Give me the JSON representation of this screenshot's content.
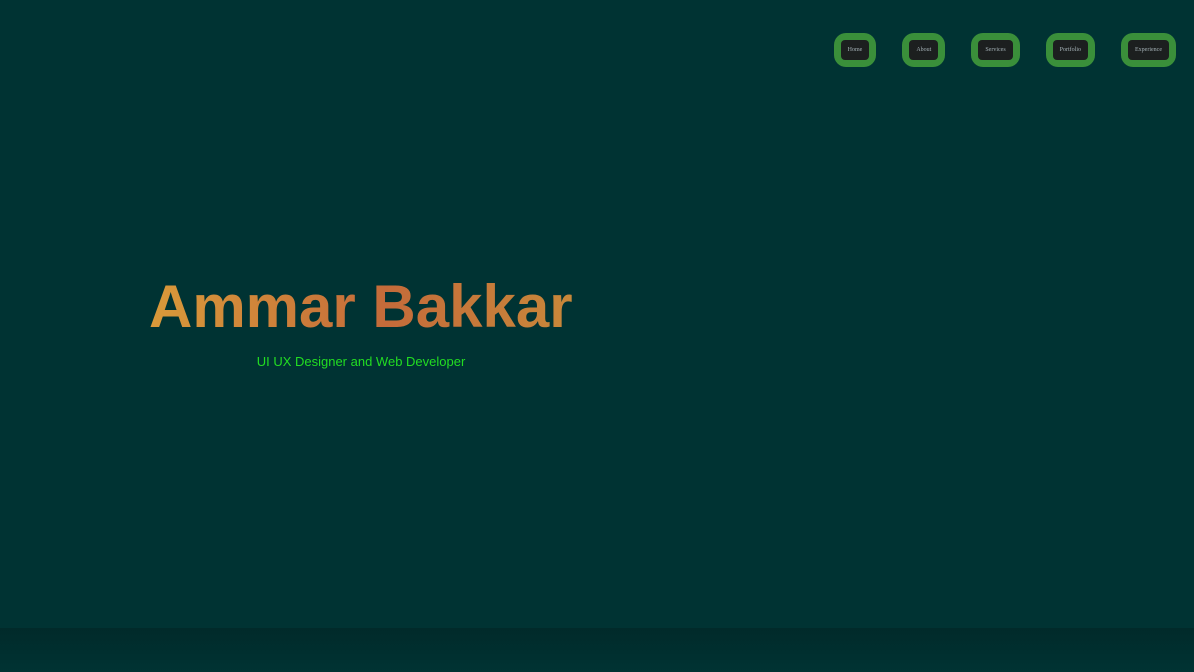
{
  "nav": {
    "items": [
      {
        "label": "Home"
      },
      {
        "label": "About"
      },
      {
        "label": "Services"
      },
      {
        "label": "Portfolio"
      },
      {
        "label": "Experience"
      }
    ]
  },
  "hero": {
    "name": "Ammar Bakkar",
    "subtitle": "UI UX Designer and Web Developer"
  },
  "colors": {
    "background": "#003333",
    "nav_button_border": "#3a8f3a",
    "nav_button_inner": "#1c1f1f",
    "title_gradient_start": "#d99a3a",
    "title_gradient_mid": "#c46b3a",
    "subtitle": "#22dd22"
  }
}
